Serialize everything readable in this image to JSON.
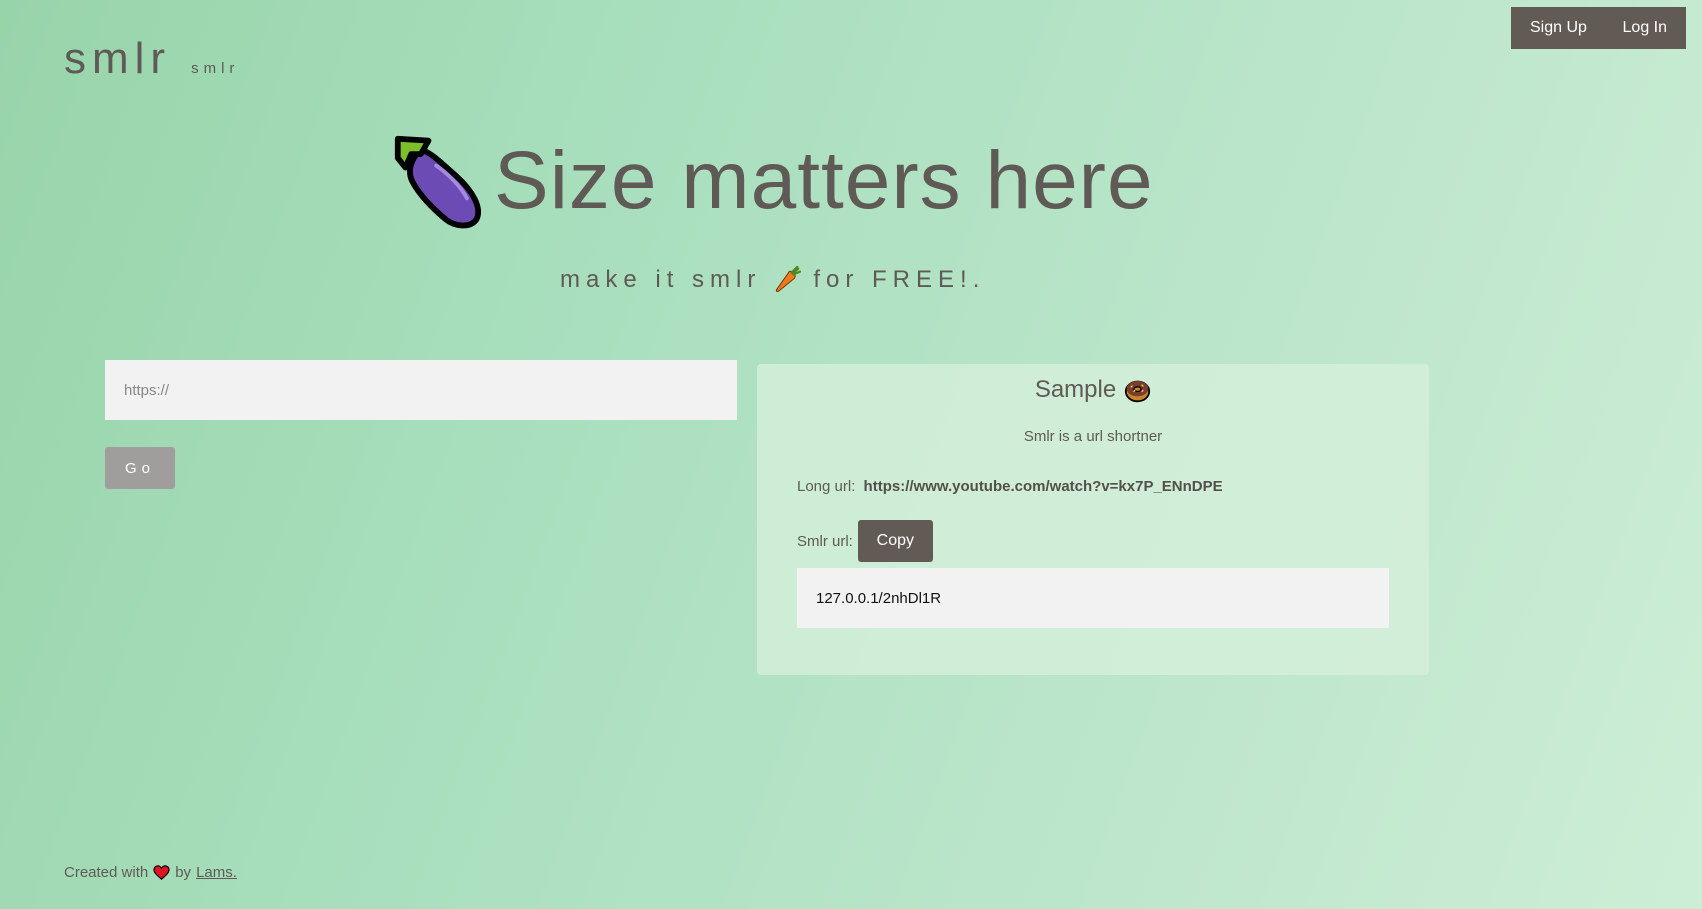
{
  "header": {
    "brand": "smlr",
    "brand_sub": "smlr",
    "nav": {
      "signup_label": "Sign Up",
      "login_label": "Log In"
    }
  },
  "hero": {
    "icon": "eggplant-icon",
    "title": "Size matters here",
    "tagline_before": "make it smlr",
    "tagline_icon": "carrot-icon",
    "tagline_after": "for FREE!."
  },
  "form": {
    "url_placeholder": "https://",
    "url_value": "",
    "go_label": "Go"
  },
  "sample": {
    "title": "Sample",
    "title_icon": "donut-icon",
    "description": "Smlr is a url shortner",
    "long_url_label": "Long url:",
    "long_url_value": "https://www.youtube.com/watch?v=kx7P_ENnDPE",
    "smlr_url_label": "Smlr url:",
    "copy_label": "Copy",
    "short_url_value": "127.0.0.1/2nhDl1R"
  },
  "footer": {
    "text_before": "Created with",
    "heart_icon": "heart-icon",
    "text_by": "by",
    "author": "Lams."
  },
  "colors": {
    "background_start": "#98d4aa",
    "background_end": "#cdeed6",
    "text": "#5f5a55",
    "dark_button": "#625a55",
    "go_button": "#a09d9d",
    "input_bg": "#f2f2f2",
    "card_bg": "#d6f0db"
  }
}
